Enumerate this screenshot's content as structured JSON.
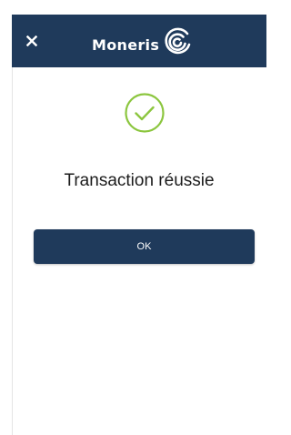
{
  "header": {
    "close_icon": "close-icon",
    "logo_text": "Moneris",
    "logo_icon": "moneris-swirl-icon",
    "background_color": "#1f3a5b"
  },
  "main": {
    "status_icon": "checkmark-circle-icon",
    "status_color": "#8cc63f",
    "title": "Transaction réussie",
    "ok_label": "OK"
  }
}
